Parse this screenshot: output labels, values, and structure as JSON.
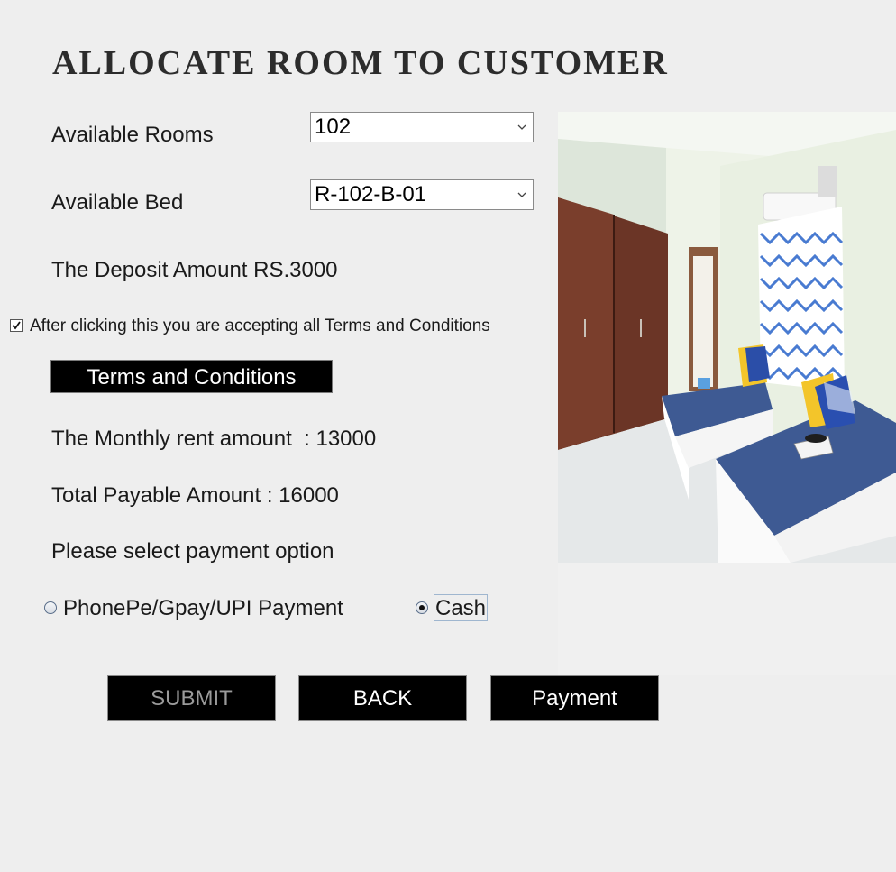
{
  "title": "ALLOCATE ROOM TO CUSTOMER",
  "form": {
    "rooms_label": "Available Rooms",
    "rooms_value": "102",
    "bed_label": "Available Bed",
    "bed_value": "R-102-B-01",
    "deposit_text": "The Deposit Amount RS.3000",
    "terms_checkbox_label": "After clicking this you are accepting all Terms and Conditions",
    "terms_checked": true,
    "terms_button": "Terms and Conditions",
    "monthly_rent_text": "The Monthly rent amount  : 13000",
    "total_payable_text": "Total Payable Amount : 16000",
    "payment_prompt": "Please select payment option",
    "payment_options": [
      {
        "label": "PhonePe/Gpay/UPI Payment",
        "selected": false
      },
      {
        "label": "Cash",
        "selected": true
      }
    ]
  },
  "buttons": {
    "submit": "SUBMIT",
    "back": "BACK",
    "payment": "Payment"
  },
  "colors": {
    "background": "#eeeeee",
    "button_bg": "#000000",
    "button_text": "#ffffff",
    "disabled_text": "#9a9a9a"
  },
  "icons": {
    "dropdown": "chevron-down-icon",
    "checkbox": "checkmark-icon"
  }
}
